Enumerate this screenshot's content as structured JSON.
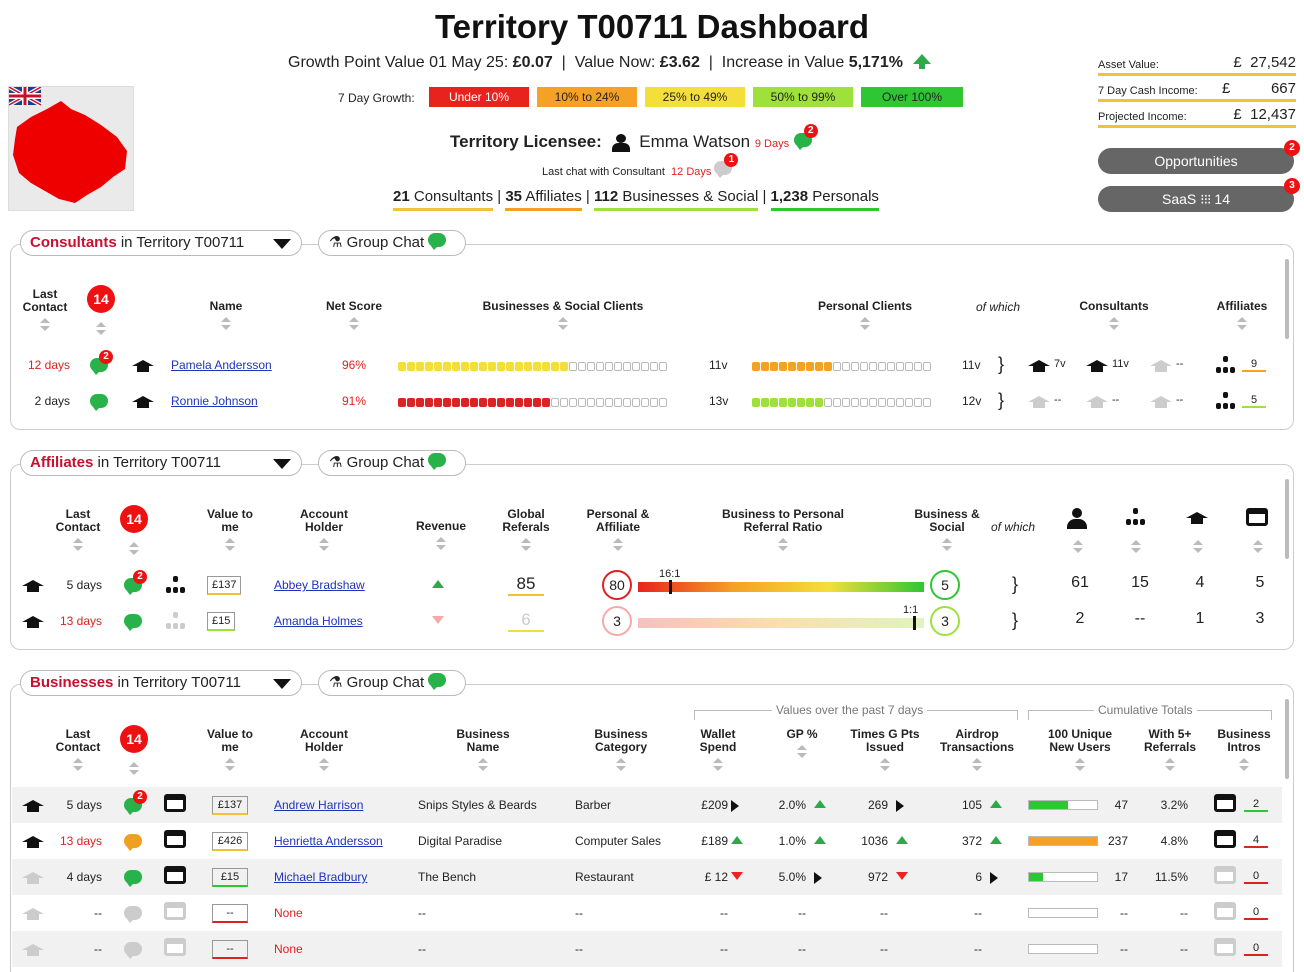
{
  "title": "Territory T00711 Dashboard",
  "growth": {
    "label1": "Growth Point Value 01 May 25:",
    "val1": "£0.07",
    "label2": "Value Now:",
    "val2": "£3.62",
    "label3": "Increase in Value",
    "val3": "5,171%",
    "seven_day_label": "7 Day Growth:",
    "chips": [
      {
        "label": "Under 10%",
        "bg": "#e8231e",
        "fg": "#fff"
      },
      {
        "label": "10% to 24%",
        "bg": "#f4a125",
        "fg": "#222"
      },
      {
        "label": "25% to 49%",
        "bg": "#f4df3a",
        "fg": "#222"
      },
      {
        "label": "50% to 99%",
        "bg": "#9ee13a",
        "fg": "#222"
      },
      {
        "label": "Over 100%",
        "bg": "#2ec633",
        "fg": "#222"
      }
    ]
  },
  "licensee": {
    "label": "Territory Licensee:",
    "name": "Emma Watson",
    "days": "9 Days",
    "badge": "2",
    "lastchat_label": "Last chat with Consultant",
    "lastchat_days": "12 Days",
    "lastchat_badge": "1"
  },
  "counts": [
    {
      "n": "21",
      "label": "Consultants",
      "color": "#f0c23a"
    },
    {
      "n": "35",
      "label": "Affiliates",
      "color": "#f4a125"
    },
    {
      "n": "112",
      "label": "Businesses & Social",
      "color": "#9ee13a"
    },
    {
      "n": "1,238",
      "label": "Personals",
      "color": "#2ec633"
    }
  ],
  "right": {
    "asset_label": "Asset Value:",
    "asset_cur": "£",
    "asset_val": "27,542",
    "cash_label": "7 Day Cash Income:",
    "cash_cur": "£",
    "cash_val": "667",
    "proj_label": "Projected Income:",
    "proj_cur": "£",
    "proj_val": "12,437",
    "opp_label": "Opportunities",
    "opp_badge": "2",
    "saas_label": "SaaS",
    "saas_count": "14",
    "saas_badge": "3"
  },
  "group_chat": "Group Chat",
  "consultants": {
    "title_hl": "Consultants",
    "title_rest": " in Territory T00711",
    "badge": "14",
    "headers": {
      "last": "Last Contact",
      "name": "Name",
      "net": "Net Score",
      "biz": "Businesses & Social Clients",
      "pers": "Personal Clients",
      "ofwhich": "of which",
      "cons": "Consultants",
      "aff": "Affiliates"
    },
    "rows": [
      {
        "days": "12 days",
        "chat_badge": "2",
        "name": "Pamela Andersson",
        "net": "96%",
        "biz_fill": 0.63,
        "biz_v": "11v",
        "pers_fill": 0.45,
        "pers_v": "11v",
        "c1": "7v",
        "c2": "11v",
        "c3": "--",
        "aff": "9"
      },
      {
        "days": "2 days",
        "chat_badge": "",
        "name": "Ronnie Johnson",
        "net": "91%",
        "biz_fill": 0.57,
        "biz_v": "13v",
        "pers_fill": 0.4,
        "pers_v": "12v",
        "c1": "--",
        "c2": "--",
        "c3": "--",
        "aff": "5"
      }
    ]
  },
  "affiliates": {
    "title_hl": "Affiliates",
    "title_rest": " in Territory T00711",
    "badge": "14",
    "headers": {
      "last": "Last Contact",
      "value": "Value to me",
      "holder": "Account Holder",
      "revenue": "Revenue",
      "global": "Global Referals",
      "pa": "Personal & Affiliate",
      "ratio": "Business to Personal Referral Ratio",
      "bs": "Business & Social",
      "ofwhich": "of which"
    },
    "rows": [
      {
        "days": "5 days",
        "value": "£137",
        "name": "Abbey Bradshaw",
        "global": "85",
        "pa": "80",
        "ratio": "16:1",
        "ratio_pos": 0.11,
        "bs": "5",
        "p": "61",
        "a": "15",
        "c": "4",
        "b": "5"
      },
      {
        "days": "13 days",
        "value": "£15",
        "name": "Amanda Holmes",
        "global": "6",
        "pa": "3",
        "ratio": "1:1",
        "ratio_pos": 0.96,
        "bs": "3",
        "p": "2",
        "a": "--",
        "c": "1",
        "b": "3"
      }
    ]
  },
  "businesses": {
    "title_hl": "Businesses",
    "title_rest": " in Territory T00711",
    "badge": "14",
    "group1": "Values over the past 7 days",
    "group2": "Cumulative Totals",
    "headers": {
      "last": "Last Contact",
      "value": "Value to me",
      "holder": "Account Holder",
      "bname": "Business Name",
      "bcat": "Business Category",
      "wallet": "Wallet Spend",
      "gp": "GP %",
      "times": "Times G Pts Issued",
      "airdrop": "Airdrop Transactions",
      "unique": "100 Unique New Users",
      "refs": "With 5+ Referrals",
      "intros": "Business Intros"
    },
    "rows": [
      {
        "days": "5 days",
        "value": "£137",
        "name": "Andrew Harrison",
        "bname": "Snips Styles & Beards",
        "bcat": "Barber",
        "wallet": "£209",
        "gp": "2.0%",
        "times": "269",
        "airdrop": "105",
        "unique_fill": 0.57,
        "unique": "47",
        "refs": "3.2%",
        "intros": "2"
      },
      {
        "days": "13 days",
        "value": "£426",
        "name": "Henrietta Andersson",
        "bname": "Digital Paradise",
        "bcat": "Computer Sales",
        "wallet": "£189",
        "gp": "1.0%",
        "times": "1036",
        "airdrop": "372",
        "unique_fill": 1.0,
        "unique": "237",
        "refs": "4.8%",
        "intros": "4"
      },
      {
        "days": "4 days",
        "value": "£15",
        "name": "Michael Bradbury",
        "bname": "The Bench",
        "bcat": "Restaurant",
        "wallet": "£  12",
        "gp": "5.0%",
        "times": "972",
        "airdrop": "6",
        "unique_fill": 0.2,
        "unique": "17",
        "refs": "11.5%",
        "intros": "0"
      },
      {
        "days": "--",
        "value": "--",
        "name": "None",
        "bname": "--",
        "bcat": "--",
        "wallet": "--",
        "gp": "--",
        "times": "--",
        "airdrop": "--",
        "unique_fill": 0,
        "unique": "--",
        "refs": "--",
        "intros": "0"
      },
      {
        "days": "--",
        "value": "--",
        "name": "None",
        "bname": "--",
        "bcat": "--",
        "wallet": "--",
        "gp": "--",
        "times": "--",
        "airdrop": "--",
        "unique_fill": 0,
        "unique": "--",
        "refs": "--",
        "intros": "0"
      }
    ]
  }
}
